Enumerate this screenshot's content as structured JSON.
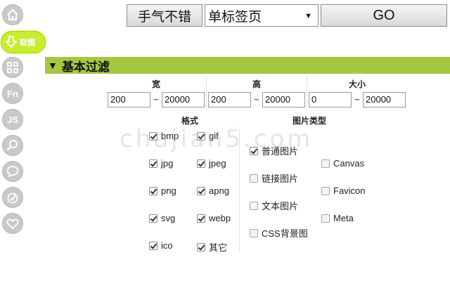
{
  "toolbar": {
    "luck_label": "手气不错",
    "tab_select_value": "单标签页",
    "go_label": "GO"
  },
  "rail": {
    "active_label": "取图",
    "fn_label": "Fn",
    "js_label": "JS"
  },
  "section": {
    "title": "基本过滤"
  },
  "filters": {
    "width_label": "宽",
    "height_label": "高",
    "size_label": "大小",
    "tilde": "~",
    "width_min": "200",
    "width_max": "20000",
    "height_min": "200",
    "height_max": "20000",
    "size_min": "0",
    "size_max": "20000"
  },
  "format": {
    "label": "格式",
    "items": [
      {
        "label": "bmp",
        "checked": true
      },
      {
        "label": "gif",
        "checked": true
      },
      {
        "label": "jpg",
        "checked": true
      },
      {
        "label": "jpeg",
        "checked": true
      },
      {
        "label": "png",
        "checked": true
      },
      {
        "label": "apng",
        "checked": true
      },
      {
        "label": "svg",
        "checked": true
      },
      {
        "label": "webp",
        "checked": true
      },
      {
        "label": "ico",
        "checked": true
      },
      {
        "label": "其它",
        "checked": true
      }
    ]
  },
  "image_type": {
    "label": "图片类型",
    "items": [
      {
        "label": "普通图片",
        "checked": true
      },
      {
        "label": "链接图片",
        "checked": false
      },
      {
        "label": "文本图片",
        "checked": false
      },
      {
        "label": "CSS背景图",
        "checked": false
      },
      {
        "label": "Canvas",
        "checked": false
      },
      {
        "label": "Favicon",
        "checked": false
      },
      {
        "label": "Meta",
        "checked": false
      }
    ]
  },
  "watermark": "chajian5.com",
  "colors": {
    "section_bar": "#a5c841",
    "active_rail": "#c6ee2f",
    "rail_idle": "#c9c9c9"
  },
  "icons": [
    "home-icon",
    "download-icon",
    "grid-icon",
    "fn-icon",
    "js-icon",
    "search-icon",
    "chat-icon",
    "check-circle-icon",
    "heart-icon"
  ]
}
